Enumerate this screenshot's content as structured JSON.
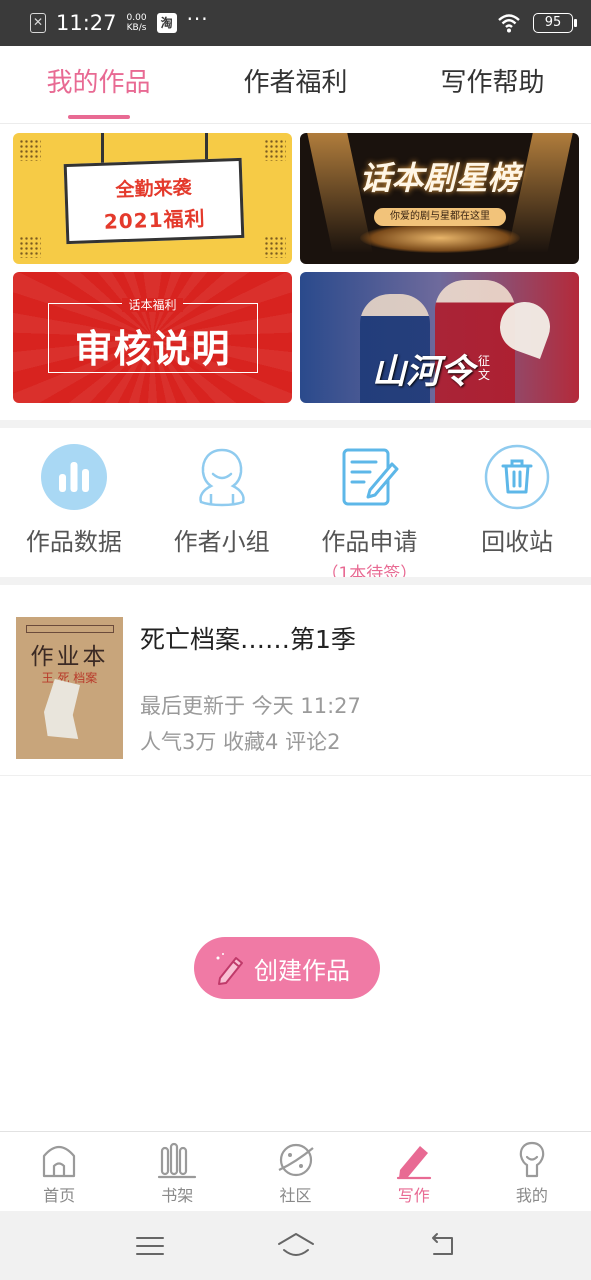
{
  "status_bar": {
    "time": "11:27",
    "speed_value": "0.00",
    "speed_unit": "KB/s",
    "taobao_icon_char": "淘",
    "more": "···",
    "battery": "95"
  },
  "tabs": [
    {
      "label": "我的作品",
      "active": true
    },
    {
      "label": "作者福利",
      "active": false
    },
    {
      "label": "写作帮助",
      "active": false
    }
  ],
  "banners": [
    {
      "line1": "全勤来袭",
      "line2": "2021福利"
    },
    {
      "title": "话本剧星榜",
      "subtitle": "你爱的剧与星都在这里"
    },
    {
      "small": "话本福利",
      "big": "审核说明"
    },
    {
      "title": "山河令",
      "subtitle": "征文"
    }
  ],
  "quick_menu": [
    {
      "label": "作品数据",
      "icon": "bar-chart-icon"
    },
    {
      "label": "作者小组",
      "icon": "people-icon"
    },
    {
      "label": "作品申请",
      "sub": "（1本待签）",
      "icon": "edit-document-icon"
    },
    {
      "label": "回收站",
      "icon": "trash-icon"
    }
  ],
  "work": {
    "title": "死亡档案……第1季",
    "updated": "最后更新于 今天 11:27",
    "stats": "人气3万 收藏4 评论2",
    "cover_title": "作业本",
    "cover_author": "王 死 档案"
  },
  "create_button": {
    "label": "创建作品"
  },
  "bottom_nav": [
    {
      "label": "首页",
      "icon": "home-icon",
      "active": false
    },
    {
      "label": "书架",
      "icon": "bookshelf-icon",
      "active": false
    },
    {
      "label": "社区",
      "icon": "planet-icon",
      "active": false
    },
    {
      "label": "写作",
      "icon": "pen-icon",
      "active": true
    },
    {
      "label": "我的",
      "icon": "profile-icon",
      "active": false
    }
  ],
  "colors": {
    "accent": "#e86a93",
    "create_button": "#f07aa5",
    "icon_blue": "#5db7e8"
  }
}
